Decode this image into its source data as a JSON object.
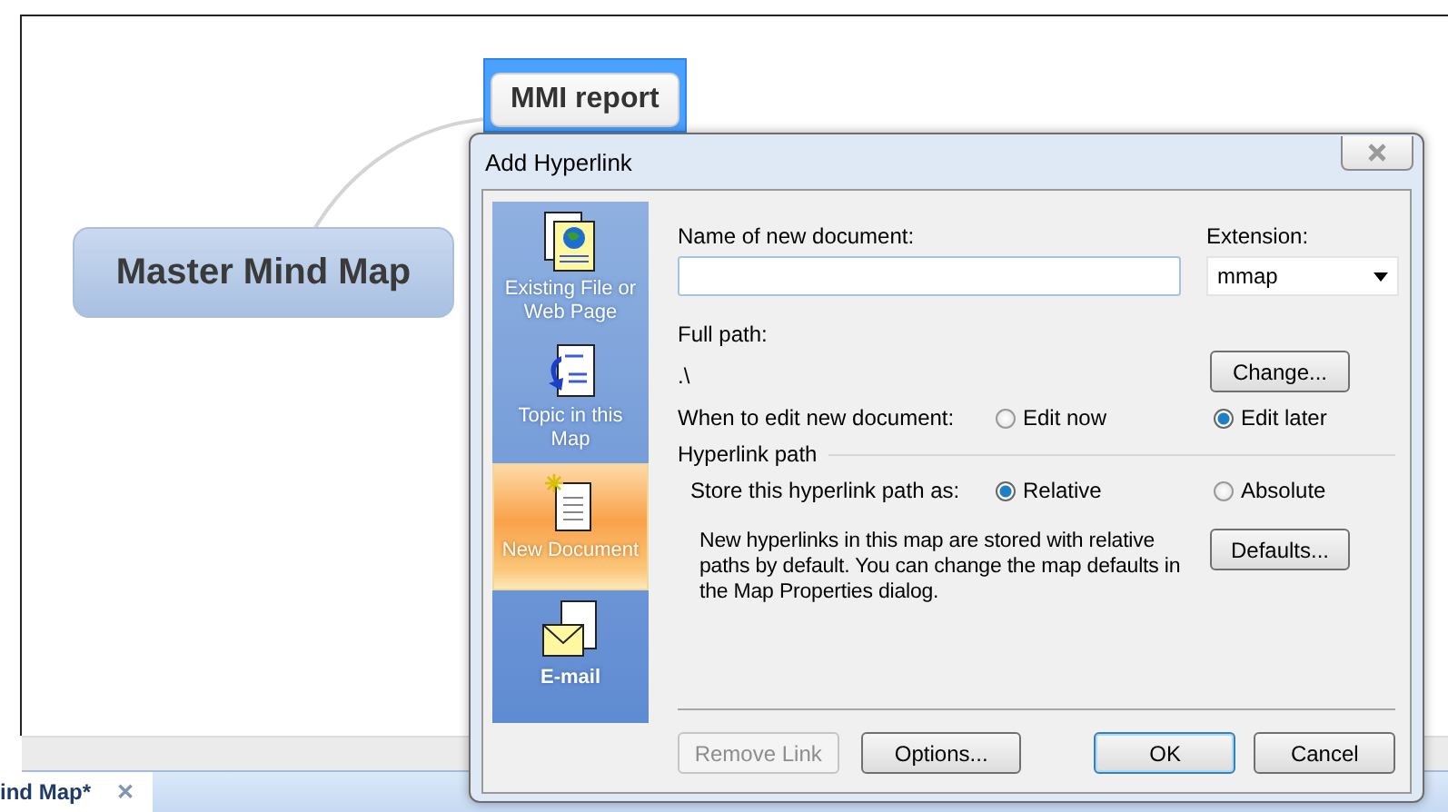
{
  "canvas": {
    "topics": [
      {
        "kind": "central",
        "text": "Master Mind Map",
        "selected": false
      },
      {
        "kind": "subtopic",
        "text": "MMI report",
        "selected": true
      }
    ]
  },
  "document_tabs": [
    {
      "label": "ind Map*",
      "selected": true,
      "close": "✕"
    }
  ],
  "dialog": {
    "title": "Add Hyperlink",
    "link_types": [
      {
        "kind": "file",
        "label": "Existing File or Web Page",
        "selected": false
      },
      {
        "kind": "topic",
        "label": "Topic in this Map",
        "selected": false
      },
      {
        "kind": "document",
        "label": "New Document",
        "selected": true
      },
      {
        "kind": "email",
        "label": "E-mail",
        "selected": false
      }
    ],
    "name_label": "Name of new document:",
    "extension_label": "Extension:",
    "extension_value": "mmap",
    "full_path_label": "Full path:",
    "full_path_value": ".\\",
    "change_button": "Change...",
    "edit_group": {
      "label": "When to edit new document:",
      "options": [
        {
          "label": "Edit now",
          "selected": false
        },
        {
          "label": "Edit later",
          "selected": true
        }
      ]
    },
    "path_section_title": "Hyperlink path",
    "store_group": {
      "label": "Store this hyperlink path as:",
      "options": [
        {
          "label": "Relative",
          "selected": true
        },
        {
          "label": "Absolute",
          "selected": false
        }
      ]
    },
    "note": "New hyperlinks in this map are stored with relative paths by default. You can change the map defaults in the Map Properties dialog.",
    "defaults_button": "Defaults...",
    "buttons": [
      {
        "label": "Remove Link",
        "disabled": true
      },
      {
        "label": "Options...",
        "disabled": false
      },
      {
        "label": "OK",
        "disabled": false,
        "default": true
      },
      {
        "label": "Cancel",
        "disabled": false,
        "default": false
      }
    ]
  }
}
